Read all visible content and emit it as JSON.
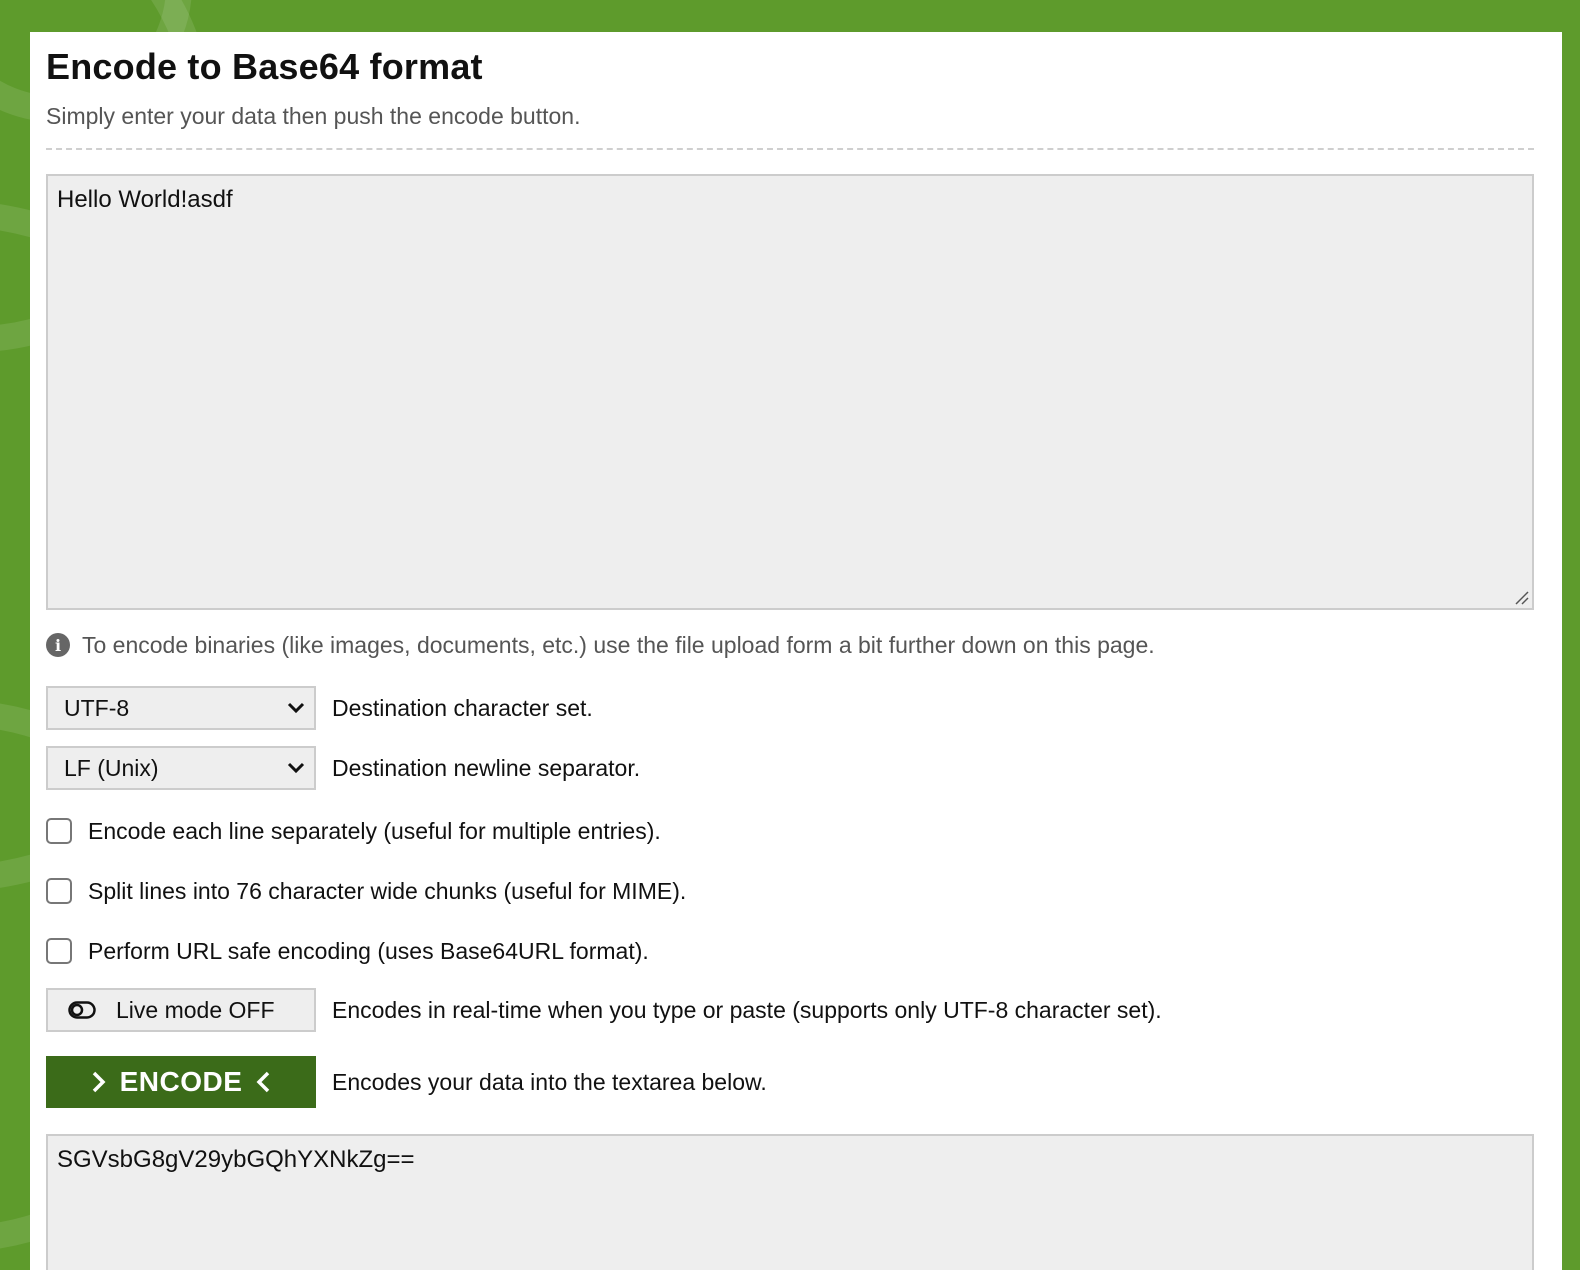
{
  "page": {
    "title": "Encode to Base64 format",
    "subtitle": "Simply enter your data then push the encode button."
  },
  "input": {
    "value": "Hello World!asdf"
  },
  "info": {
    "text": "To encode binaries (like images, documents, etc.) use the file upload form a bit further down on this page."
  },
  "options": {
    "charset": {
      "selected": "UTF-8",
      "label": "Destination character set."
    },
    "newline": {
      "selected": "LF (Unix)",
      "label": "Destination newline separator."
    },
    "checkboxes": [
      {
        "label": "Encode each line separately (useful for multiple entries).",
        "checked": false
      },
      {
        "label": "Split lines into 76 character wide chunks (useful for MIME).",
        "checked": false
      },
      {
        "label": "Perform URL safe encoding (uses Base64URL format).",
        "checked": false
      }
    ],
    "live_mode": {
      "label": "Live mode OFF",
      "description": "Encodes in real-time when you type or paste (supports only UTF-8 character set)."
    }
  },
  "encode": {
    "label": "ENCODE",
    "description": "Encodes your data into the textarea below."
  },
  "output": {
    "value": "SGVsbG8gV29ybGQhYXNkZg=="
  },
  "colors": {
    "background": "#5e9b2c",
    "encode_button": "#3b6b19",
    "field_bg": "#eeeeee"
  },
  "icons": {
    "info": "info-icon",
    "chevron": "chevron-down-icon",
    "toggle": "toggle-off-icon",
    "encode_left": "chevron-right-icon",
    "encode_right": "chevron-left-icon"
  }
}
